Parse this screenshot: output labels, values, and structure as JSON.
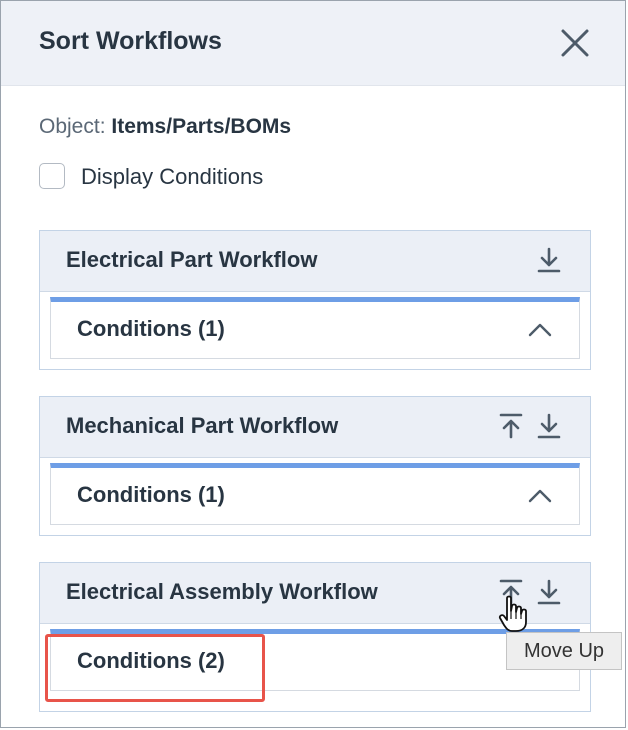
{
  "dialog": {
    "title": "Sort Workflows"
  },
  "object": {
    "label": "Object:",
    "value": "Items/Parts/BOMs"
  },
  "display_conditions": {
    "label": "Display Conditions",
    "checked": false
  },
  "workflows": [
    {
      "title": "Electrical Part Workflow",
      "conditions_label": "Conditions (1)",
      "actions": [
        "move-down"
      ]
    },
    {
      "title": "Mechanical Part Workflow",
      "conditions_label": "Conditions (1)",
      "actions": [
        "move-to-top",
        "move-down"
      ]
    },
    {
      "title": "Electrical Assembly Workflow",
      "conditions_label": "Conditions (2)",
      "actions": [
        "move-to-top",
        "move-down"
      ]
    }
  ],
  "tooltip": {
    "text": "Move Up"
  },
  "colors": {
    "accent": "#6e9ee6",
    "highlight": "#e8544a",
    "header_bg": "#eef1f7"
  }
}
